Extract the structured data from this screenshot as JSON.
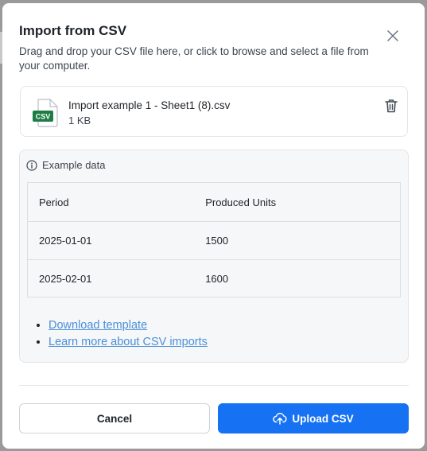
{
  "dialog": {
    "title": "Import from CSV",
    "description": "Drag and drop your CSV file here, or click to browse and select a file from your computer."
  },
  "file": {
    "icon_label": "CSV",
    "name": "Import example 1 - Sheet1 (8).csv",
    "size": "1 KB"
  },
  "example": {
    "heading": "Example data",
    "columns": [
      "Period",
      "Produced Units"
    ],
    "rows": [
      [
        "2025-01-01",
        "1500"
      ],
      [
        "2025-02-01",
        "1600"
      ]
    ]
  },
  "links": {
    "download_template": "Download template",
    "learn_more": "Learn more about CSV imports"
  },
  "actions": {
    "cancel": "Cancel",
    "upload": "Upload CSV"
  },
  "icons": {
    "close": "close-icon",
    "trash": "trash-icon",
    "info": "info-icon",
    "csv_file": "csv-file-icon",
    "upload": "cloud-upload-icon"
  },
  "colors": {
    "primary": "#1672f3",
    "link": "#4a8fd9",
    "csv_badge": "#1e7d45"
  }
}
